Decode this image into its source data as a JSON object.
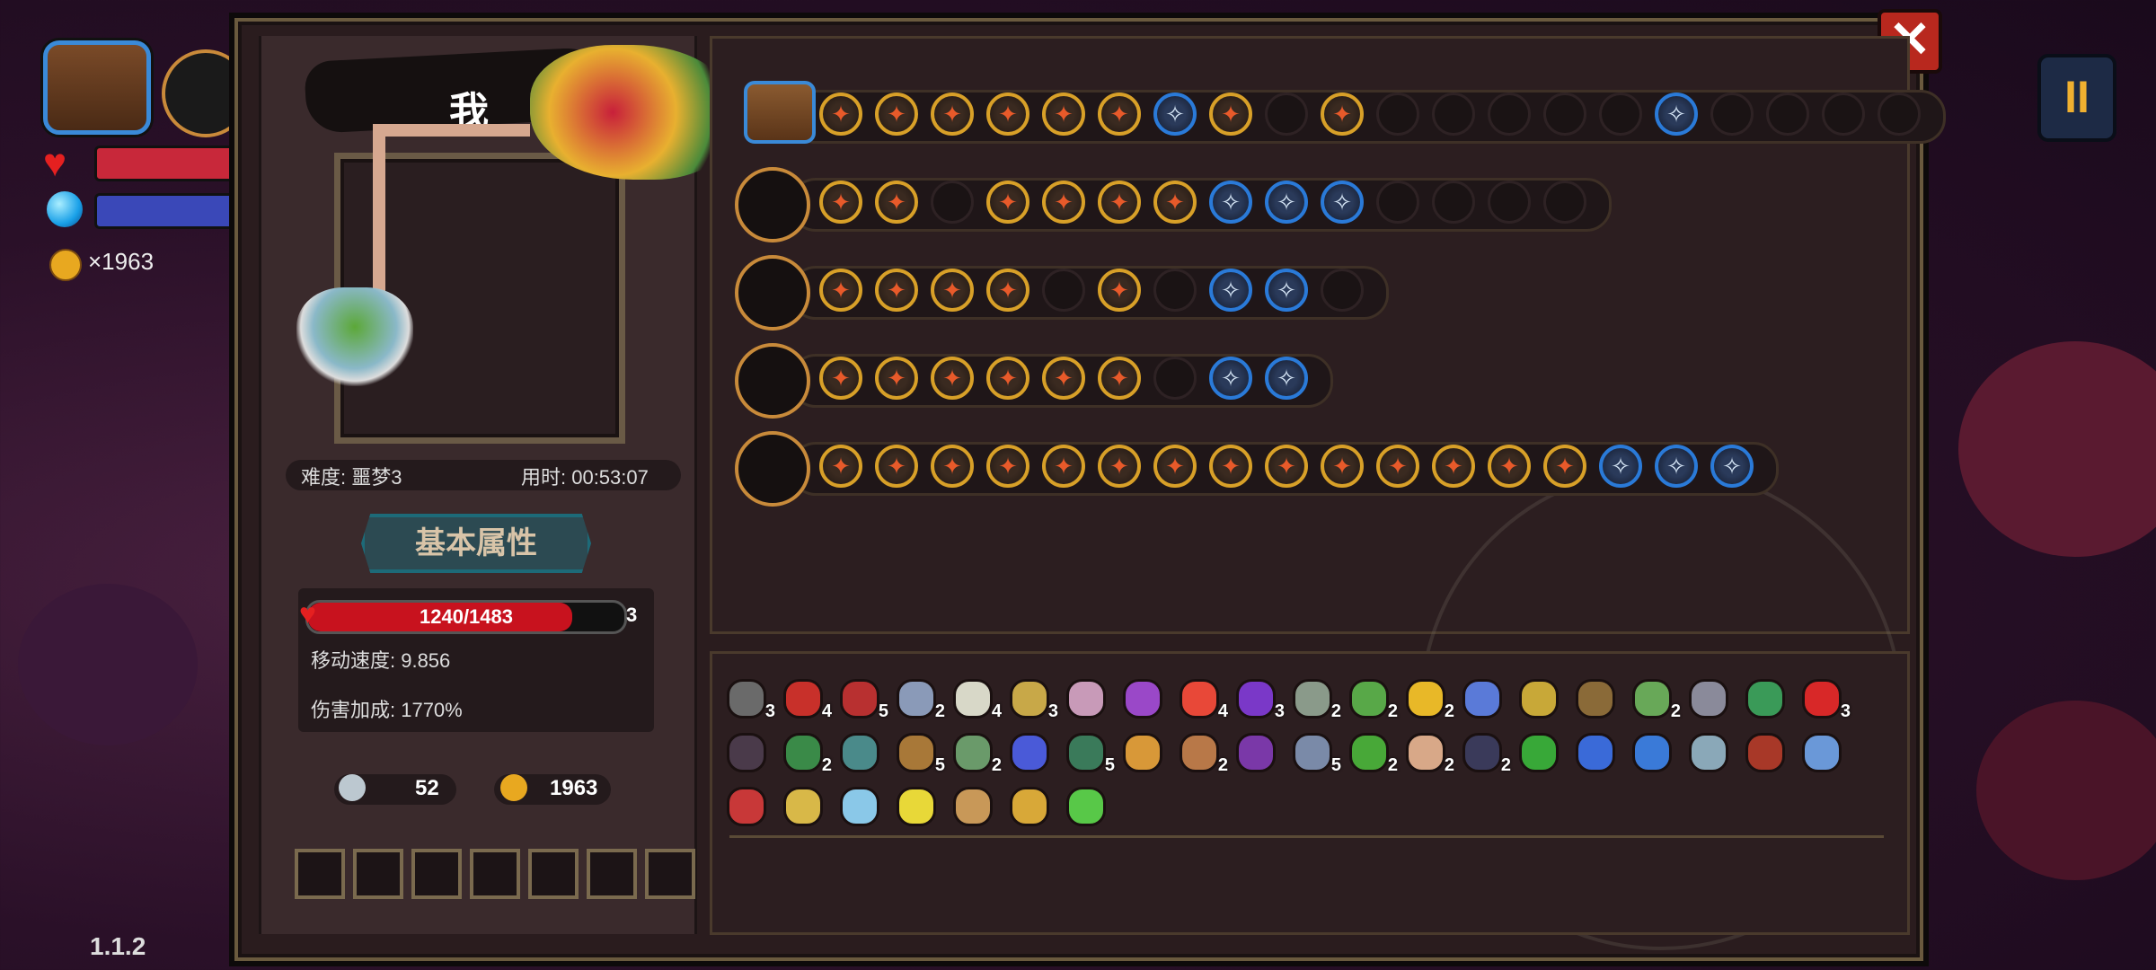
{
  "hud": {
    "gold_text": "×1963",
    "version": "1.1.2",
    "pause_label": "II",
    "close_label": "✕"
  },
  "character": {
    "name": "我",
    "difficulty": "难度: 噩梦3",
    "time_used": "用时: 00:53:07"
  },
  "attributes": {
    "section_title": "基本属性",
    "hp_text": "1240/1483",
    "hp_fraction": 0.836,
    "hp_count": "3",
    "move_speed": "移动速度: 9.856",
    "damage_bonus": "伤害加成: 1770%"
  },
  "resources": {
    "keys": "52",
    "gold": "1963"
  },
  "equipment_slots": 7,
  "weapon_rows": [
    {
      "weapon": "chest-icon",
      "gems": [
        "gold",
        "gold",
        "gold",
        "gold",
        "gold",
        "gold",
        "blue",
        "gold",
        "empty",
        "gold",
        "empty",
        "empty",
        "empty",
        "empty",
        "empty",
        "blue",
        "empty",
        "empty",
        "empty",
        "empty"
      ]
    },
    {
      "weapon": "staff-icon",
      "gems": [
        "gold",
        "gold",
        "empty",
        "gold",
        "gold",
        "gold",
        "gold",
        "blue",
        "blue",
        "blue",
        "empty",
        "empty",
        "empty",
        "empty"
      ]
    },
    {
      "weapon": "scepter-icon",
      "gems": [
        "gold",
        "gold",
        "gold",
        "gold",
        "empty",
        "gold",
        "empty",
        "blue",
        "blue",
        "empty"
      ]
    },
    {
      "weapon": "crystal-wand-icon",
      "gems": [
        "gold",
        "gold",
        "gold",
        "gold",
        "gold",
        "gold",
        "empty",
        "blue",
        "blue"
      ]
    },
    {
      "weapon": "spear-icon",
      "gems": [
        "gold",
        "gold",
        "gold",
        "gold",
        "gold",
        "gold",
        "gold",
        "gold",
        "gold",
        "gold",
        "gold",
        "gold",
        "gold",
        "gold",
        "blue",
        "blue",
        "blue"
      ]
    }
  ],
  "items": [
    {
      "c": "#6a6a6a",
      "n": "3"
    },
    {
      "c": "#c8302a",
      "n": "4"
    },
    {
      "c": "#b83030",
      "n": "5"
    },
    {
      "c": "#8a9ab8",
      "n": "2"
    },
    {
      "c": "#d8d8c8",
      "n": "4"
    },
    {
      "c": "#c8a848",
      "n": "3"
    },
    {
      "c": "#c89ab8",
      "n": ""
    },
    {
      "c": "#9a48c8",
      "n": ""
    },
    {
      "c": "#e84838",
      "n": "4"
    },
    {
      "c": "#7a38c8",
      "n": "3"
    },
    {
      "c": "#8a9a8a",
      "n": "2"
    },
    {
      "c": "#58a848",
      "n": "2"
    },
    {
      "c": "#e8b828",
      "n": "2"
    },
    {
      "c": "#5a7ad8",
      "n": ""
    },
    {
      "c": "#c8a838",
      "n": ""
    },
    {
      "c": "#8a6a38",
      "n": ""
    },
    {
      "c": "#68a858",
      "n": "2"
    },
    {
      "c": "#8a8a9a",
      "n": ""
    },
    {
      "c": "#3a9a58",
      "n": ""
    },
    {
      "c": "#d82828",
      "n": "3"
    },
    {
      "c": "#4a3a4a",
      "n": ""
    },
    {
      "c": "#3a8a48",
      "n": "2"
    },
    {
      "c": "#4a8a8a",
      "n": ""
    },
    {
      "c": "#a87838",
      "n": "5"
    },
    {
      "c": "#6a9a6a",
      "n": "2"
    },
    {
      "c": "#4a5ad8",
      "n": ""
    },
    {
      "c": "#3a7a5a",
      "n": "5"
    },
    {
      "c": "#d89838",
      "n": ""
    },
    {
      "c": "#b87848",
      "n": "2"
    },
    {
      "c": "#7a38a8",
      "n": ""
    },
    {
      "c": "#7a8aa8",
      "n": "5"
    },
    {
      "c": "#48a838",
      "n": "2"
    },
    {
      "c": "#d8a888",
      "n": "2"
    },
    {
      "c": "#3a3a5a",
      "n": "2"
    },
    {
      "c": "#38a838",
      "n": ""
    },
    {
      "c": "#3a6ad8",
      "n": ""
    },
    {
      "c": "#3a7ad8",
      "n": ""
    },
    {
      "c": "#8aa8b8",
      "n": ""
    },
    {
      "c": "#a83828",
      "n": ""
    },
    {
      "c": "#6a98d8",
      "n": ""
    },
    {
      "c": "#c83838",
      "n": ""
    },
    {
      "c": "#d8b848",
      "n": ""
    },
    {
      "c": "#8ac8e8",
      "n": ""
    },
    {
      "c": "#e8d838",
      "n": ""
    },
    {
      "c": "#c89858",
      "n": ""
    },
    {
      "c": "#d8a838",
      "n": ""
    },
    {
      "c": "#58c848",
      "n": ""
    }
  ],
  "colors": {
    "gem_gold": "#d8a028",
    "gem_blue": "#2a7ad8",
    "panel": "#2a1c1e",
    "hp_red": "#c8121e"
  }
}
